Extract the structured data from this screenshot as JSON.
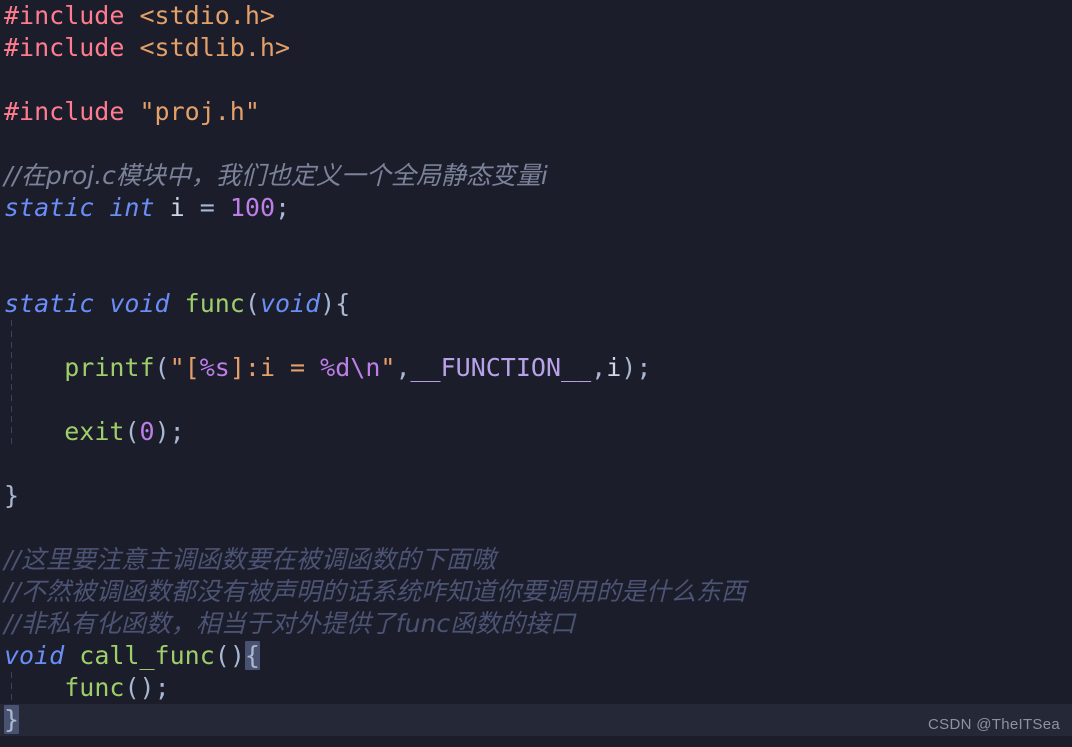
{
  "editor": {
    "language": "c",
    "theme_name": "dark",
    "background_color": "#1b1d2b",
    "active_line_color": "#252837",
    "bracket_match_color": "#4a5272",
    "indent_guide_color": "#3c4260",
    "font_size_px": 25,
    "line_height_px": 32,
    "colors": {
      "preprocessor": "#ff7b8e",
      "header": "#e5a06a",
      "string": "#e5a06a",
      "keyword": "#6b8df6",
      "function": "#9ece6a",
      "number": "#bd7ee8",
      "format_specifier": "#bd7ee8",
      "macro": "#b9a3e8",
      "punctuation": "#a9b7d0",
      "variable": "#cdd6e4",
      "comment": "#4c5373",
      "comment_light": "#7b8299",
      "watermark": "#8d93a3"
    }
  },
  "code": {
    "lines": [
      {
        "n": 1,
        "text": "#include <stdio.h>"
      },
      {
        "n": 2,
        "text": "#include <stdlib.h>"
      },
      {
        "n": 3,
        "text": ""
      },
      {
        "n": 4,
        "text": "#include \"proj.h\""
      },
      {
        "n": 5,
        "text": ""
      },
      {
        "n": 6,
        "text": "//在proj.c模块中，我们也定义一个全局静态变量i"
      },
      {
        "n": 7,
        "text": "static int i = 100;"
      },
      {
        "n": 8,
        "text": ""
      },
      {
        "n": 9,
        "text": ""
      },
      {
        "n": 10,
        "text": "static void func(void){"
      },
      {
        "n": 11,
        "text": ""
      },
      {
        "n": 12,
        "text": "    printf(\"[%s]:i = %d\\n\",__FUNCTION__,i);"
      },
      {
        "n": 13,
        "text": ""
      },
      {
        "n": 14,
        "text": "    exit(0);"
      },
      {
        "n": 15,
        "text": ""
      },
      {
        "n": 16,
        "text": "}"
      },
      {
        "n": 17,
        "text": ""
      },
      {
        "n": 18,
        "text": "//这里要注意主调函数要在被调函数的下面嗷"
      },
      {
        "n": 19,
        "text": "//不然被调函数都没有被声明的话系统咋知道你要调用的是什么东西"
      },
      {
        "n": 20,
        "text": "//非私有化函数，相当于对外提供了func函数的接口"
      },
      {
        "n": 21,
        "text": "void call_func(){"
      },
      {
        "n": 22,
        "text": "    func();"
      },
      {
        "n": 23,
        "text": "}"
      }
    ],
    "tokens": {
      "include_directive": "#include",
      "header_stdio": "<stdio.h>",
      "header_stdlib": "<stdlib.h>",
      "header_proj": "\"proj.h\"",
      "kw_static": "static",
      "kw_int": "int",
      "kw_void": "void",
      "var_i": "i",
      "op_assign": "=",
      "num_100": "100",
      "num_0": "0",
      "semicolon": ";",
      "fn_func": "func",
      "fn_printf": "printf",
      "fn_exit": "exit",
      "fn_call_func": "call_func",
      "paren_open": "(",
      "paren_close": ")",
      "brace_open": "{",
      "brace_close": "}",
      "comma": ",",
      "macro_function": "__FUNCTION__",
      "str_quote": "\"",
      "str_bracket_open": "[",
      "str_bracket_close": "]",
      "str_colon_i_eq": ":i = ",
      "fmt_s": "%s",
      "fmt_d": "%d",
      "fmt_newline": "\\n",
      "comment_proj": "//在proj.c模块中，我们也定义一个全局静态变量i",
      "comment_order": "//这里要注意主调函数要在被调函数的下面嗷",
      "comment_declare": "//不然被调函数都没有被声明的话系统咋知道你要调用的是什么东西",
      "comment_interface": "//非私有化函数，相当于对外提供了func函数的接口"
    }
  },
  "watermark": {
    "text": "CSDN @TheITSea"
  }
}
